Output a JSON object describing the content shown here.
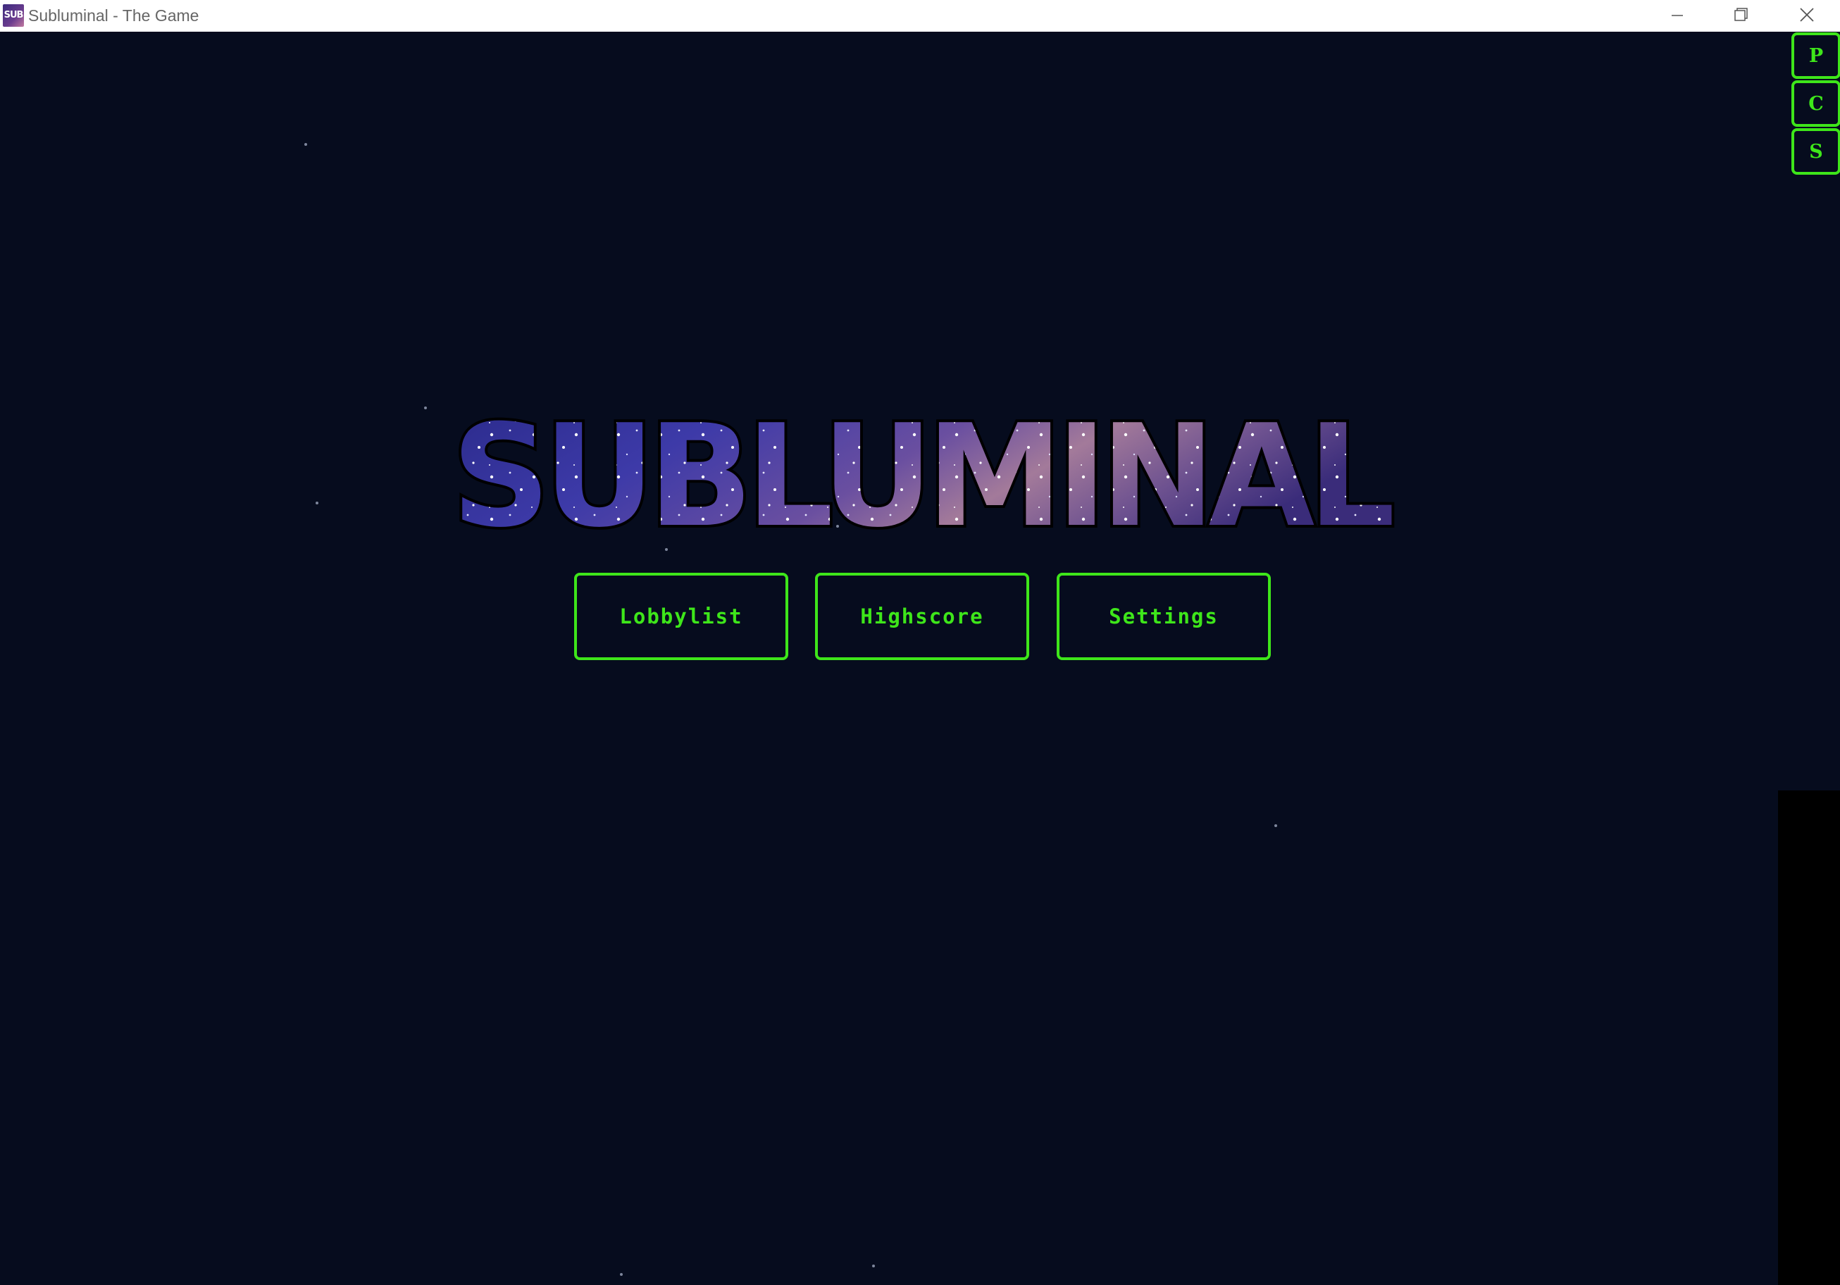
{
  "window": {
    "title": "Subluminal - The Game",
    "icon_label": "SUB",
    "controls": {
      "minimize_icon": "minimize-icon",
      "maximize_icon": "restore-icon",
      "close_icon": "close-icon"
    }
  },
  "logo": {
    "text": "SUBLUMINAL"
  },
  "menu": {
    "buttons": [
      {
        "label": "Lobbylist"
      },
      {
        "label": "Highscore"
      },
      {
        "label": "Settings"
      }
    ]
  },
  "side_buttons": [
    {
      "label": "P"
    },
    {
      "label": "C"
    },
    {
      "label": "S"
    }
  ],
  "colors": {
    "background": "#060c1e",
    "accent": "#3ee61a",
    "title_bar": "#ffffff"
  }
}
